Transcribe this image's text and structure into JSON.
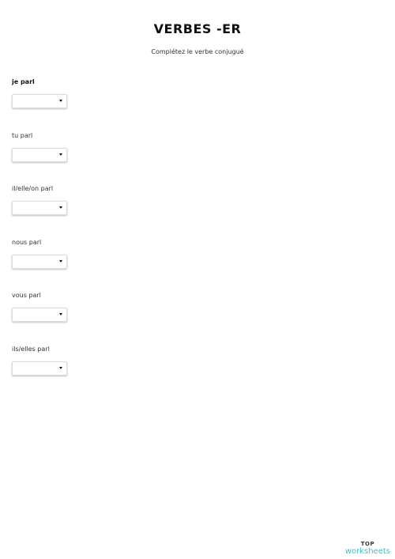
{
  "header": {
    "title": "VERBES -ER",
    "subtitle": "Complétez le verbe conjugué"
  },
  "items": [
    {
      "label": "je parl",
      "selected": ""
    },
    {
      "label": "tu parl",
      "selected": ""
    },
    {
      "label": "il/elle/on parl",
      "selected": ""
    },
    {
      "label": "nous parl",
      "selected": ""
    },
    {
      "label": "vous parl",
      "selected": ""
    },
    {
      "label": "ils/elles parl",
      "selected": ""
    }
  ],
  "logo": {
    "top": "TOP",
    "bottom": "worksheets"
  },
  "colors": {
    "logo_accent": "#3fc1c9",
    "logo_dark": "#2b3a4a"
  },
  "icons": {
    "dropdown": "caret-down-icon"
  }
}
